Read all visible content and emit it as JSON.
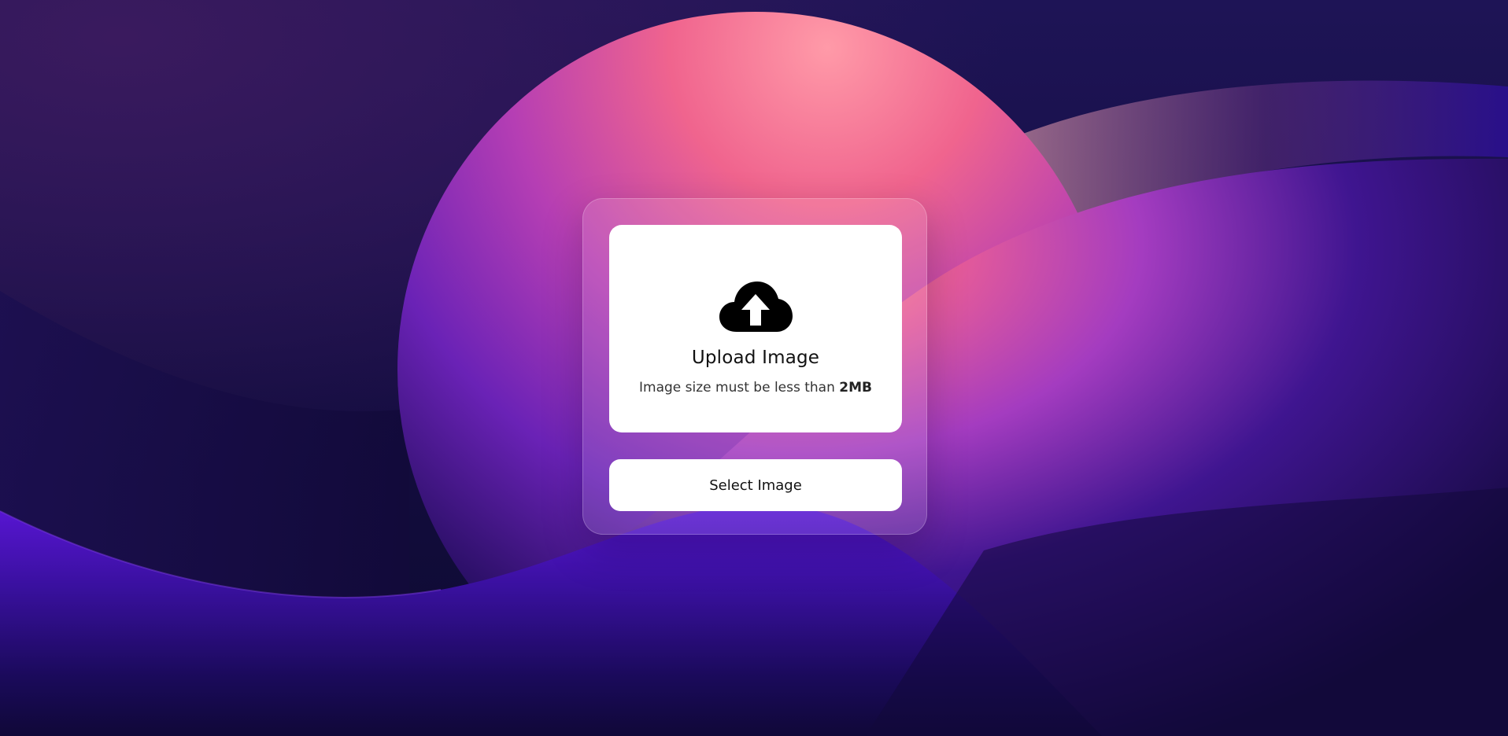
{
  "upload": {
    "title": "Upload Image",
    "hint_prefix": "Image size must be less than",
    "hint_limit": "2MB",
    "icon": "cloud-upload-icon"
  },
  "select_button_label": "Select Image",
  "colors": {
    "background_dark": "#130d40",
    "sphere_pink": "#ff8fa0",
    "sphere_purple": "#8a2fc8",
    "wave_purple": "#5a18d8",
    "card": "#ffffff"
  }
}
